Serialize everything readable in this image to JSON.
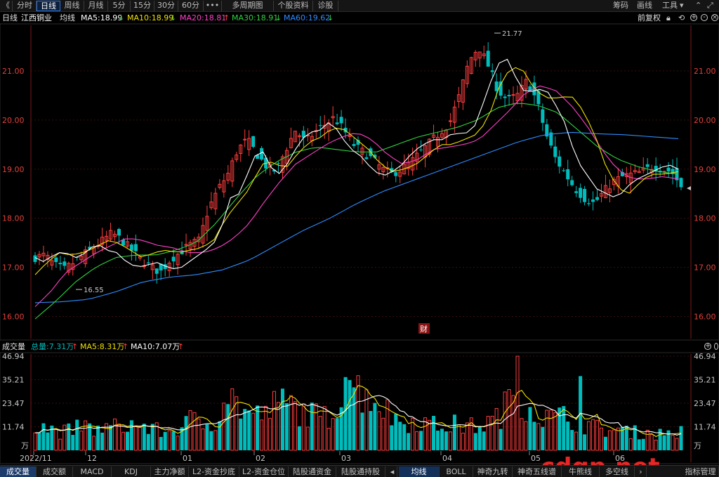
{
  "toolbar": {
    "back": "《",
    "tabs": [
      "分时",
      "日线",
      "周线",
      "月线",
      "5分",
      "15分",
      "30分",
      "60分",
      "•••",
      "多周期图",
      "个股资料",
      "诊股"
    ],
    "active_tab": "日线",
    "right": [
      "筹码",
      "画线",
      "工具"
    ]
  },
  "info": {
    "period": "日线",
    "stock": "江西铜业",
    "mode": "均线",
    "ma5": "MA5:18.99",
    "ma10": "MA10:18.99",
    "ma20": "MA20:18.81",
    "ma30": "MA30:18.91",
    "ma60": "MA60:19.62",
    "fq": "前复权"
  },
  "volume_info": {
    "title": "成交量",
    "total": "总量:7.31万",
    "ma5": "MA5:8.31万",
    "ma10": "MA10:7.07万"
  },
  "colors": {
    "up": "#ff3d3d",
    "down": "#00bdbd",
    "ma5": "#ffffff",
    "ma10": "#f0e000",
    "ma20": "#ff40c8",
    "ma30": "#30d040",
    "ma60": "#2e8cff"
  },
  "chart_data": [
    {
      "type": "candlestick",
      "y_ticks": [
        "21.00",
        "20.00",
        "19.00",
        "18.00",
        "17.00",
        "16.00"
      ],
      "ylim": [
        15.75,
        21.9
      ],
      "annotations": [
        {
          "label": "21.77",
          "x": "2023-04",
          "y": 21.77
        },
        {
          "label": "16.55",
          "x": "2022-11",
          "y": 16.55
        },
        {
          "label": "财",
          "x": "2023-03",
          "y": 15.75
        }
      ],
      "price_path": [
        17.2,
        17.25,
        17.05,
        16.95,
        17.1,
        17.25,
        17.4,
        17.55,
        17.7,
        17.55,
        17.35,
        17.15,
        17.0,
        16.9,
        17.15,
        17.3,
        17.45,
        17.55,
        18.2,
        18.6,
        18.9,
        19.4,
        19.6,
        19.3,
        19.05,
        18.95,
        19.4,
        19.8,
        19.55,
        19.75,
        19.9,
        20.05,
        19.8,
        19.5,
        19.35,
        19.2,
        19.0,
        18.9,
        19.0,
        19.15,
        19.35,
        19.55,
        19.75,
        19.95,
        20.5,
        21.2,
        21.5,
        21.1,
        20.6,
        20.4,
        20.5,
        20.8,
        20.4,
        19.7,
        19.2,
        18.9,
        18.6,
        18.4,
        18.3,
        18.55,
        18.75,
        18.85,
        18.9,
        18.95,
        19.05,
        19.0,
        18.95,
        18.65
      ],
      "ma": {
        "ma5": [
          17.2,
          17.1,
          17.3,
          17.3,
          17.2,
          17.3,
          17.5,
          17.35,
          17.3,
          17.1,
          17.0,
          17.05,
          17.1,
          17.0,
          16.95,
          17.1,
          17.25,
          17.4,
          17.6,
          18.4,
          18.5,
          19.0,
          19.5,
          19.05,
          18.9,
          19.2,
          19.6,
          19.75,
          19.8,
          20.0,
          19.65,
          19.4,
          19.25,
          19.0,
          18.85,
          18.95,
          19.1,
          19.35,
          19.5,
          19.6,
          19.6,
          19.75,
          19.7,
          19.85,
          20.4,
          21.0,
          21.35,
          20.9,
          20.55,
          20.6,
          20.65,
          20.3,
          19.9,
          19.2,
          18.9,
          18.6,
          18.5,
          18.4,
          18.65,
          18.8,
          18.9,
          19.0,
          19.1,
          19.0
        ],
        "ma10": [
          16.85,
          17.1,
          17.3,
          17.25,
          17.3,
          17.4,
          17.55,
          17.5,
          17.35,
          17.2,
          17.3,
          17.35,
          17.3,
          17.35,
          17.4,
          17.55,
          18.0,
          18.3,
          18.6,
          19.1,
          19.15,
          19.0,
          19.3,
          19.55,
          19.65,
          19.85,
          19.8,
          19.6,
          19.4,
          19.1,
          18.95,
          19.0,
          19.1,
          19.3,
          19.5,
          19.5,
          19.6,
          19.7,
          20.0,
          20.7,
          21.1,
          21.0,
          20.6,
          20.45,
          20.45,
          20.5,
          20.2,
          19.7,
          19.0,
          18.6,
          18.5,
          18.8,
          18.9,
          18.9,
          18.95
        ],
        "ma20": [
          16.2,
          16.5,
          16.9,
          17.1,
          17.3,
          17.45,
          17.6,
          17.55,
          17.45,
          17.4,
          17.3,
          17.3,
          17.4,
          17.6,
          17.9,
          18.35,
          18.75,
          19.1,
          19.3,
          19.5,
          19.65,
          19.75,
          19.6,
          19.3,
          19.1,
          19.2,
          19.4,
          19.45,
          19.5,
          19.6,
          19.9,
          20.2,
          20.55,
          20.7,
          20.6,
          20.3,
          19.9,
          19.4,
          19.0,
          18.8,
          18.8,
          18.85,
          18.8
        ],
        "ma30": [
          15.95,
          16.3,
          16.7,
          17.0,
          17.2,
          17.25,
          17.25,
          17.35,
          17.5,
          17.9,
          18.4,
          18.85,
          19.15,
          19.35,
          19.45,
          19.4,
          19.35,
          19.35,
          19.5,
          19.65,
          19.75,
          19.85,
          20.0,
          20.25,
          20.35,
          20.3,
          20.15,
          19.8,
          19.45,
          19.2,
          19.05,
          18.95,
          18.9
        ],
        "ma60": [
          16.28,
          16.3,
          16.35,
          16.5,
          16.7,
          16.8,
          16.85,
          16.95,
          17.15,
          17.45,
          17.75,
          18.0,
          18.3,
          18.55,
          18.75,
          18.95,
          19.15,
          19.35,
          19.55,
          19.7,
          19.75,
          19.72,
          19.7,
          19.66,
          19.62
        ]
      }
    },
    {
      "type": "bar",
      "y_ticks": [
        "46.94",
        "35.21",
        "23.47",
        "11.74"
      ],
      "y_unit": "万",
      "ylim": [
        0,
        46.94
      ],
      "x_labels": [
        "2022/11",
        "12",
        "01",
        "02",
        "03",
        "04",
        "05",
        "06"
      ],
      "volume_profile": [
        14,
        11,
        9,
        10,
        12,
        10,
        11,
        12,
        13,
        12,
        10,
        9,
        11,
        15,
        13,
        14,
        30,
        22,
        18,
        17,
        22,
        24,
        20,
        18,
        16,
        18,
        42,
        30,
        28,
        22,
        16,
        14,
        15,
        13,
        12,
        13,
        12,
        12,
        14,
        18,
        30,
        24,
        18,
        16,
        17,
        15,
        13,
        11,
        10,
        10,
        9,
        9,
        8,
        9,
        9
      ]
    }
  ],
  "bottom_tabs": [
    "成交量",
    "成交额",
    "MACD",
    "KDJ",
    "主力净额",
    "L2-资金抄底",
    "L2-资金仓位",
    "陆股通资金",
    "陆股通持股"
  ],
  "bottom_tabs2": [
    "均线",
    "BOLL",
    "神奇九转",
    "神奇五线谱",
    "牛熊线",
    "多空线"
  ],
  "bottom_right": "指标管理",
  "watermark": "cdgp.net"
}
